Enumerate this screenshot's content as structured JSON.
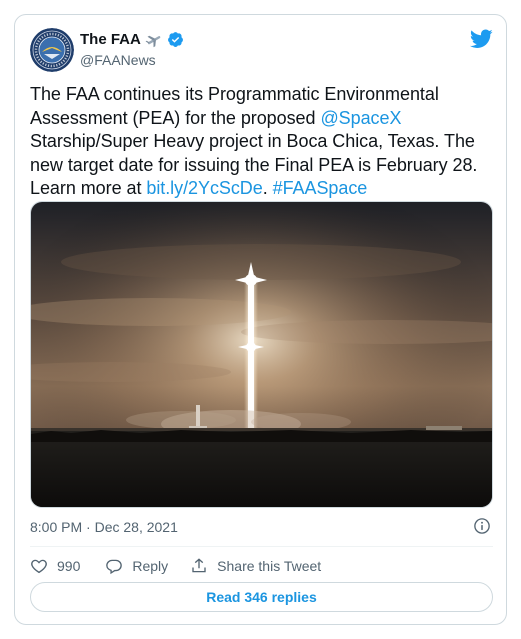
{
  "author": {
    "display_name": "The FAA",
    "handle": "@FAANews"
  },
  "tweet": {
    "segments": [
      {
        "text": "The FAA continues its Programmatic Environmental Assessment (PEA) for the proposed ",
        "link": false
      },
      {
        "text": "@SpaceX",
        "link": true
      },
      {
        "text": " Starship/Super Heavy project in Boca Chica, Texas. The new target date for issuing the Final PEA is February 28. Learn more at ",
        "link": false
      },
      {
        "text": "bit.ly/2YcScDe",
        "link": true
      },
      {
        "text": ". ",
        "link": false
      },
      {
        "text": "#FAASpace",
        "link": true
      }
    ]
  },
  "meta": {
    "timestamp": "8:00 PM · Dec 28, 2021"
  },
  "actions": {
    "like_count": "990",
    "reply_label": "Reply",
    "share_label": "Share this Tweet"
  },
  "replies_button": {
    "label": "Read 346 replies"
  },
  "colors": {
    "link": "#1b95e0",
    "verified": "#1d9bf0",
    "twitter_bird": "#1d9bf0"
  },
  "icons": [
    "faa-seal-icon",
    "airplane-emoji-icon",
    "verified-badge-icon",
    "twitter-bird-icon",
    "info-icon",
    "heart-icon",
    "reply-icon",
    "share-icon"
  ]
}
